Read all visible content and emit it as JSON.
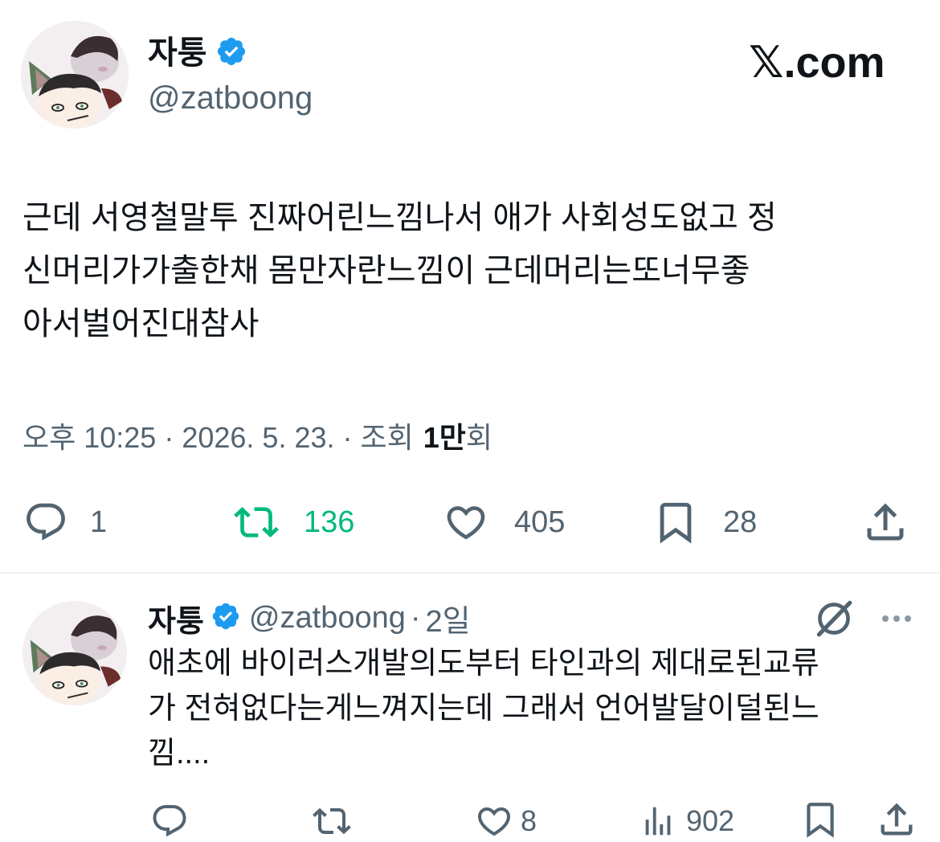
{
  "colors": {
    "text": "#0f1419",
    "muted": "#536471",
    "verified": "#1d9bf0",
    "retweeted": "#00ba7c"
  },
  "main_tweet": {
    "author_name": "자퉁",
    "author_handle": "@zatboong",
    "brand": "𝕏.com",
    "text_lines": [
      "근데 서영철말투 진짜어린느낌나서 애가 사회성도없고 정",
      "신머리가가출한채 몸만자란느낌이 근데머리는또너무좋",
      "아서벌어진대참사"
    ],
    "meta": {
      "time": "오후 10:25",
      "date": "2026. 5. 23.",
      "views_label": "조회",
      "views_count": "1만",
      "views_suffix": "회",
      "sep": "·"
    },
    "actions": {
      "replies": "1",
      "retweets": "136",
      "likes": "405",
      "bookmarks": "28"
    },
    "icons": [
      "reply-icon",
      "retweet-icon",
      "like-icon",
      "bookmark-icon",
      "share-icon",
      "verified-badge-icon"
    ]
  },
  "reply_tweet": {
    "author_name": "자퉁",
    "author_handle": "@zatboong",
    "sep": "·",
    "age": "2일",
    "text_lines": [
      "애초에 바이러스개발의도부터 타인과의 제대로된교류",
      "가 전혀없다는게느껴지는데 그래서 언어발달이덜된느",
      "낌...."
    ],
    "actions": {
      "replies": "",
      "retweets": "",
      "likes": "8",
      "views": "902"
    },
    "icons": [
      "grok-icon",
      "more-icon",
      "reply-icon",
      "retweet-icon",
      "like-icon",
      "views-icon",
      "bookmark-icon",
      "share-icon"
    ]
  }
}
